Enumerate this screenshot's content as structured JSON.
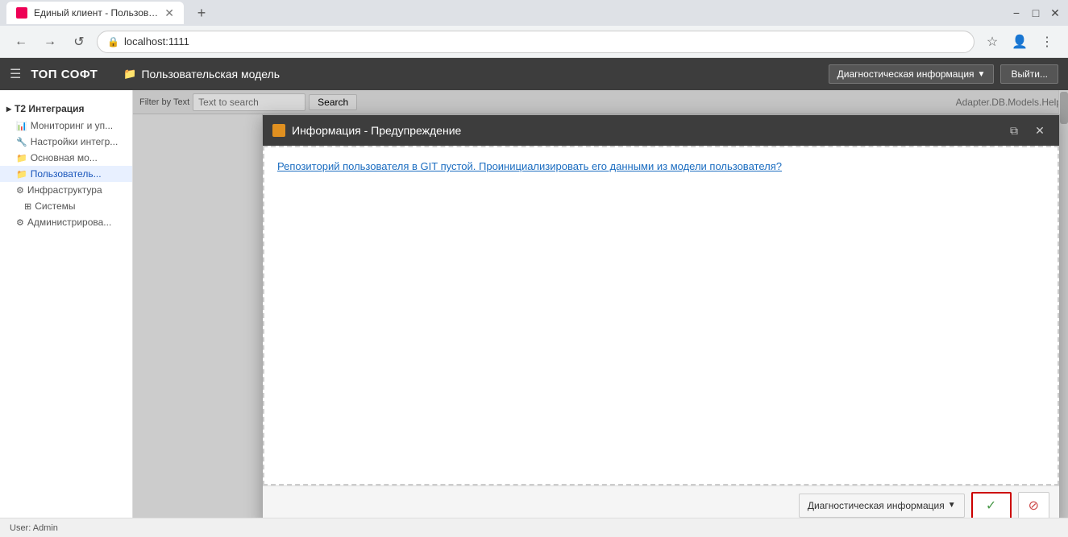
{
  "browser": {
    "tab_title": "Единый клиент - Пользователъ...",
    "url": "localhost:1111",
    "new_tab_icon": "+",
    "back_icon": "←",
    "forward_icon": "→",
    "refresh_icon": "↺",
    "minimize_icon": "−",
    "maximize_icon": "□",
    "close_icon": "✕"
  },
  "topbar": {
    "brand": "ТОП СОФТ",
    "page_title": "Пользовательская модель",
    "diag_dropdown_label": "Диагностическая информация",
    "logout_label": "Выйти..."
  },
  "sidebar": {
    "section_title": "Т2 Интеграция",
    "items": [
      {
        "label": "Мониторинг и уп...",
        "icon": "📊"
      },
      {
        "label": "Настройки интегр...",
        "icon": "🔧"
      },
      {
        "label": "Основная мо...",
        "icon": "📁"
      },
      {
        "label": "Пользователь...",
        "icon": "📁"
      },
      {
        "label": "Инфраструктура",
        "icon": "⚙"
      },
      {
        "label": "Системы",
        "icon": "⊞"
      },
      {
        "label": "Администрирова...",
        "icon": "⚙"
      }
    ]
  },
  "content_toolbar": {
    "filter_label": "Filter by Text",
    "search_placeholder": "Text to search",
    "search_btn": "Search"
  },
  "content": {
    "right_panel_text": "Adapter.DB.Models.Help"
  },
  "modal": {
    "title": "Информация - Предупреждение",
    "message": "Репозиторий пользователя в GIT пустой. Проинициализировать его данными из модели пользователя?",
    "footer_diag_label": "Диагностическая информация",
    "confirm_icon": "✓",
    "cancel_icon": "🚫"
  },
  "status_bar": {
    "user_label": "User: Admin"
  }
}
